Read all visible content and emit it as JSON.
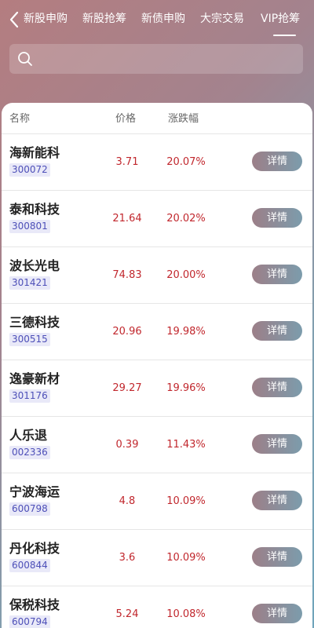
{
  "nav": {
    "tabs": [
      {
        "label": "新股申购"
      },
      {
        "label": "新股抢筹"
      },
      {
        "label": "新债申购"
      },
      {
        "label": "大宗交易"
      },
      {
        "label": "VIP抢筹"
      }
    ],
    "active_tab": "VIP抢筹"
  },
  "search": {
    "placeholder": ""
  },
  "table": {
    "headers": {
      "name": "名称",
      "price": "价格",
      "change": "涨跌幅"
    },
    "rows": [
      {
        "name": "海新能科",
        "code": "300072",
        "price": "3.71",
        "change": "20.07%",
        "action": "详情"
      },
      {
        "name": "泰和科技",
        "code": "300801",
        "price": "21.64",
        "change": "20.02%",
        "action": "详情"
      },
      {
        "name": "波长光电",
        "code": "301421",
        "price": "74.83",
        "change": "20.00%",
        "action": "详情"
      },
      {
        "name": "三德科技",
        "code": "300515",
        "price": "20.96",
        "change": "19.98%",
        "action": "详情"
      },
      {
        "name": "逸豪新材",
        "code": "301176",
        "price": "29.27",
        "change": "19.96%",
        "action": "详情"
      },
      {
        "name": "人乐退",
        "code": "002336",
        "price": "0.39",
        "change": "11.43%",
        "action": "详情"
      },
      {
        "name": "宁波海运",
        "code": "600798",
        "price": "4.8",
        "change": "10.09%",
        "action": "详情"
      },
      {
        "name": "丹化科技",
        "code": "600844",
        "price": "3.6",
        "change": "10.09%",
        "action": "详情"
      },
      {
        "name": "保税科技",
        "code": "600794",
        "price": "5.24",
        "change": "10.08%",
        "action": "详情"
      }
    ]
  },
  "colors": {
    "up": "#c1272d",
    "code_text": "#4d4fb8"
  }
}
